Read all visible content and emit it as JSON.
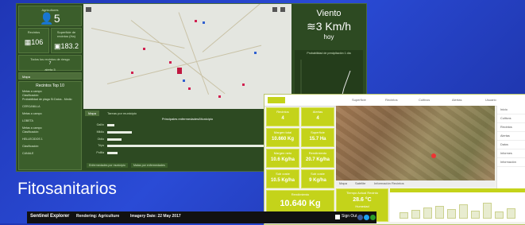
{
  "dashboard": {
    "agricultores": {
      "label": "Agricultores",
      "value": "5"
    },
    "recintos": {
      "label": "Recintos",
      "value": "106"
    },
    "superficie": {
      "label": "Superficie de recintos (Ha)",
      "value": "183.2"
    },
    "total_recintos": {
      "label": "Todos los recintos de riesgo",
      "value": "7"
    },
    "riesgo": {
      "label": "alerta 5"
    },
    "nav_label": "Mapa",
    "list_title": "Recintos Top 10",
    "list_items": [
      "Metas a campo\nClasificación:\nProbabilidad de plaga Sí:Datos - Medio",
      "CERCANILLA",
      "Metas a campo",
      "LOBETA",
      "Metas a campo\nClasificación:",
      "HELLECIDOS 1",
      "Clasificación:",
      "CANALE"
    ],
    "tabs": [
      "Mapa",
      "Tareas por municipio"
    ],
    "chart_title": "Principales enfermedades/Municipio",
    "chart_categories": [
      "Gallín",
      "Mildiu",
      "Oidio",
      "Trips",
      "Polilla"
    ],
    "chart_values": [
      4,
      14,
      8,
      98,
      6
    ],
    "bottom_tabs": [
      "Enfermedades por municipio",
      "Malas por enfermedades"
    ],
    "wind": {
      "title": "Viento",
      "value": "3 Km/h",
      "sub": "hoy",
      "chart_label": "Probabilidad de precipitación 1 día"
    },
    "section_title": "Fitosanitarios"
  },
  "yg_dashboard": {
    "top_labels": [
      "Superficie",
      "Recintos",
      "Cultivos",
      "Alertas",
      "Usuario"
    ],
    "cards": [
      {
        "title": "Recintos",
        "value": "4"
      },
      {
        "title": "Alertas",
        "value": "4"
      },
      {
        "title": "Margen total",
        "value": "10.660 Kg"
      },
      {
        "title": "Superficie",
        "value": "15.7 Ha"
      },
      {
        "title": "Margen neto",
        "value": "10.6 Kg/ha"
      },
      {
        "title": "Rendimiento",
        "value": "20.7 Kg/ha"
      },
      {
        "title": "Sub coste",
        "value": "10.5 Kg/ha"
      },
      {
        "title": "Sub coste",
        "value": "9 Kg/ha"
      }
    ],
    "big_value": "10.640 Kg",
    "big_label": "Rendimiento",
    "weather": {
      "title": "Tiempo Actual Recinto",
      "temp": "28.6 °C",
      "hum": "Humedad"
    },
    "menu_items": [
      "Inicio",
      "Cultivos",
      "Recintos",
      "Alertas",
      "Datos",
      "Informes",
      "Información"
    ],
    "map_tabs": [
      "Mapa",
      "Satélite",
      "Información Recintos"
    ]
  },
  "sentinel": {
    "title": "Sentinel Explorer",
    "rendering": "Rendering: Agriculture",
    "imagery": "Imagery Date: 22 May 2017",
    "sign_out": "Sign Out"
  },
  "colors": {
    "dark_green": "#2d4a22",
    "accent_green": "#c4d31a",
    "blue_bg": "#2a4bd6"
  }
}
